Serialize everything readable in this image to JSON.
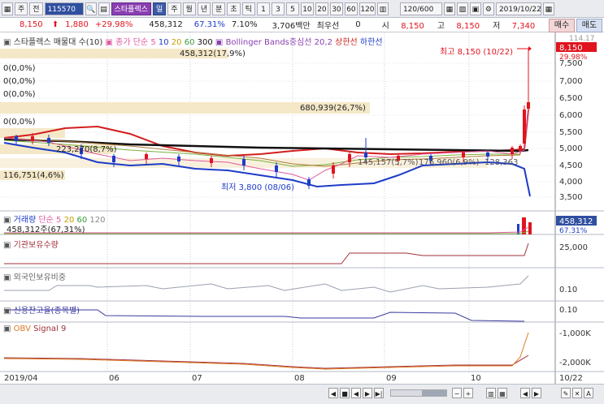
{
  "toolbar": {
    "period_day": "주",
    "view_all": "전",
    "code": "115570",
    "stock_name": "스타플렉스",
    "period_buttons": [
      "일",
      "주",
      "월",
      "년",
      "분",
      "초",
      "틱"
    ],
    "interval_buttons": [
      "1",
      "3",
      "5",
      "10",
      "20",
      "30",
      "60",
      "120"
    ],
    "count": "120/600",
    "date": "2019/10/22"
  },
  "quote": {
    "price": "8,150",
    "change": "1,880",
    "change_pct": "+29.98%",
    "volume": "458,312",
    "vol_ratio": "67.31%",
    "turnover": "7.10%",
    "amount": "3,706백만",
    "pref": "최우선",
    "pref_val": "0",
    "open_label": "시",
    "open": "8,150",
    "high_label": "고",
    "high": "8,150",
    "low_label": "저",
    "low": "7,340",
    "buy": "매수",
    "sell": "매도"
  },
  "legend": {
    "main": "스타플렉스 매물대 수(10)",
    "ma": "종가 단순 5",
    "ma_periods": [
      "10",
      "20",
      "60",
      "300"
    ],
    "bb": "Bollinger Bands중심선 20,2",
    "bb_upper": "상한선",
    "bb_lower": "하한선",
    "volume": "거래량",
    "vol_ma": "단순 5",
    "vol_ma_periods": [
      "20",
      "60",
      "120"
    ],
    "vol_value": "458,312주(67,31%)",
    "inst": "기관보유수량",
    "foreign": "외국인보유비중",
    "credit": "신용잔고율(종목별)",
    "obv": "OBV",
    "obv_signal": "Signal 9"
  },
  "annotations": {
    "high": "최고 8,150 (10/22)",
    "low": "최저 3,800 (08/06)",
    "vp1": "458,312(17,9%)",
    "vp2": "680,939(26,7%)",
    "vp3": "116,751(4,6%)",
    "vp4": "223,270(8,7%)",
    "vp5": "145,157(5,7%)",
    "vp6": "176,960(6,9%)",
    "vp7": "128,363",
    "zero1": "0(0,0%)",
    "zero2": "0(0,0%)",
    "zero3": "0(0,0%)",
    "zero4": "0(0,0%)",
    "partial_top": "114.17"
  },
  "y_axis": {
    "price_ticks": [
      "7,500",
      "7,000",
      "6,500",
      "6,000",
      "5,500",
      "5,000",
      "4,500",
      "4,000",
      "3,500"
    ],
    "last_price": "8,150",
    "last_pct": "29.98%",
    "volume_tick": "458,312",
    "volume_pct": "67.31%",
    "inst_tick": "25,000",
    "foreign_tick": "0.10",
    "credit_tick": "0.10",
    "obv_ticks": [
      "-1,000K",
      "-2,000K"
    ]
  },
  "x_axis": {
    "labels": [
      "2019/04",
      "06",
      "07",
      "08",
      "09",
      "10",
      "10/22"
    ]
  },
  "colors": {
    "up": "#e0141e",
    "down": "#1d3bc8",
    "ma5": "#e05aa0",
    "bb_upper": "#d21e1e",
    "bb_lower": "#1d3bc8",
    "ma300": "#111111",
    "volume_profile": "#f5e8c8"
  }
}
